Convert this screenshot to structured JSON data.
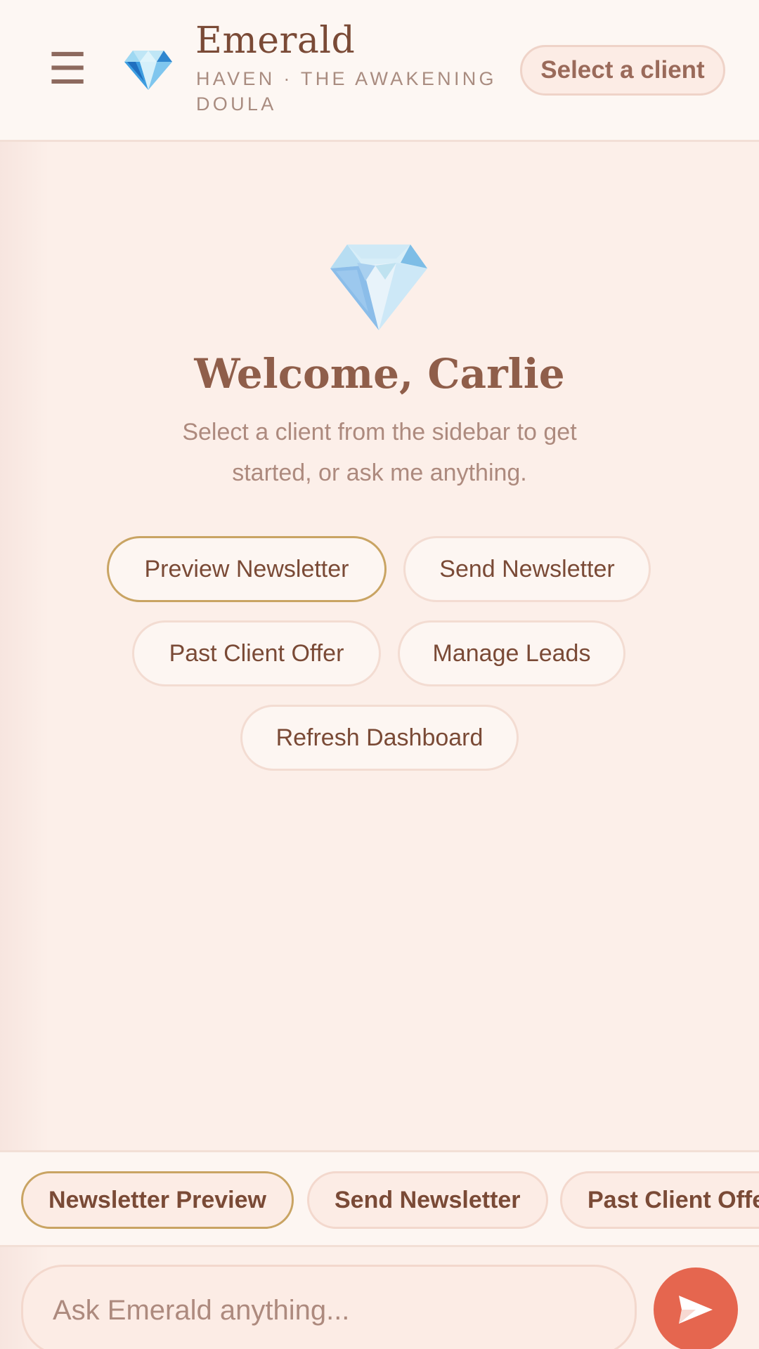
{
  "colors": {
    "accent": "#e5664f",
    "brand_text": "#7a4a36",
    "highlight_border": "#c9a463",
    "background": "#fcefe9"
  },
  "header": {
    "menu_icon": "hamburger-icon",
    "menu_glyph": "☰",
    "logo_icon": "diamond-icon",
    "brand_name": "Emerald",
    "brand_subtitle": "HAVEN · THE AWAKENING DOULA",
    "client_select_label": "Select a client"
  },
  "welcome": {
    "icon": "diamond-icon",
    "title": "Welcome, Carlie",
    "subtitle": "Select a client from the sidebar to get started, or ask me anything."
  },
  "actions": [
    {
      "label": "Preview Newsletter",
      "highlighted": true
    },
    {
      "label": "Send Newsletter",
      "highlighted": false
    },
    {
      "label": "Past Client Offer",
      "highlighted": false
    },
    {
      "label": "Manage Leads",
      "highlighted": false
    },
    {
      "label": "Refresh Dashboard",
      "highlighted": false
    }
  ],
  "chips": [
    {
      "label": "Newsletter Preview",
      "highlighted": true
    },
    {
      "label": "Send Newsletter",
      "highlighted": false
    },
    {
      "label": "Past Client Offer",
      "highlighted": false
    }
  ],
  "composer": {
    "placeholder": "Ask Emerald anything...",
    "send_icon": "send-icon"
  }
}
